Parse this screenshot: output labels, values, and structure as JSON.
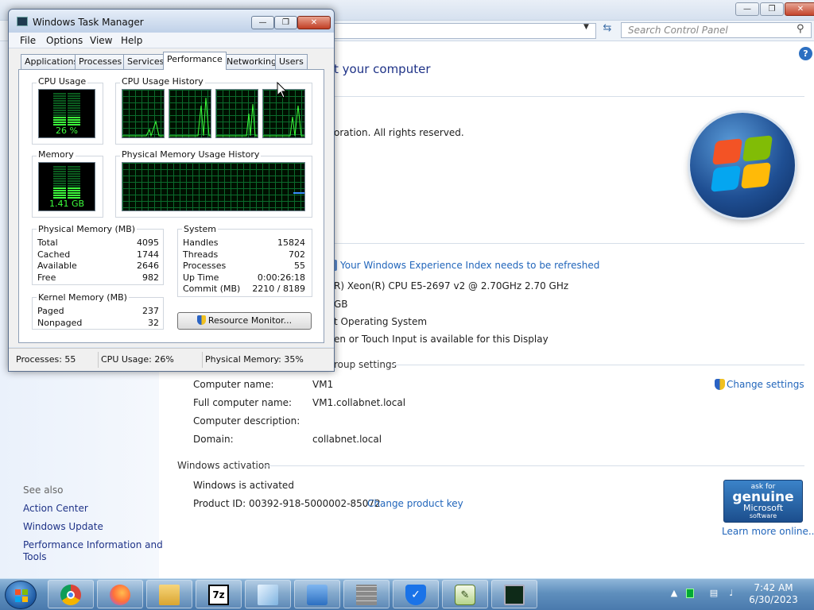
{
  "control_panel": {
    "search_placeholder": "Search Control Panel",
    "heading": "t your computer",
    "copyright": "oration.  All rights reserved.",
    "rating_link": "Your Windows Experience Index needs to be refreshed",
    "processor": "R) Xeon(R) CPU E5-2697 v2 @ 2.70GHz   2.70 GHz",
    "ram": "GB",
    "system_type": "t Operating System",
    "pen_touch": "en or Touch Input is available for this Display",
    "group_heading": "roup settings",
    "change_settings": "Change settings",
    "computer_name_label": "Computer name:",
    "computer_name": "VM1",
    "full_name_label": "Full computer name:",
    "full_name": "VM1.collabnet.local",
    "description_label": "Computer description:",
    "domain_label": "Domain:",
    "domain": "collabnet.local",
    "activation_heading": "Windows activation",
    "activated": "Windows is activated",
    "product_id": "Product ID: 00392-918-5000002-85072",
    "change_key": "Change product key",
    "learn_more": "Learn more online...",
    "genuine": {
      "line1": "ask for",
      "line2": "genuine",
      "line3": "Microsoft",
      "line4": "software"
    },
    "see_also": "See also",
    "see_also_links": [
      "Action Center",
      "Windows Update",
      "Performance Information and",
      "Tools"
    ]
  },
  "task_manager": {
    "title": "Windows Task Manager",
    "menu": [
      "File",
      "Options",
      "View",
      "Help"
    ],
    "tabs": [
      "Applications",
      "Processes",
      "Services",
      "Performance",
      "Networking",
      "Users"
    ],
    "active_tab": "Performance",
    "cpu_usage_label": "CPU Usage",
    "cpu_usage_value": "26 %",
    "cpu_history_label": "CPU Usage History",
    "memory_label": "Memory",
    "memory_value": "1.41 GB",
    "mem_history_label": "Physical Memory Usage History",
    "physical_memory": {
      "label": "Physical Memory (MB)",
      "rows": [
        {
          "name": "Total",
          "value": "4095"
        },
        {
          "name": "Cached",
          "value": "1744"
        },
        {
          "name": "Available",
          "value": "2646"
        },
        {
          "name": "Free",
          "value": "982"
        }
      ]
    },
    "kernel_memory": {
      "label": "Kernel Memory (MB)",
      "rows": [
        {
          "name": "Paged",
          "value": "237"
        },
        {
          "name": "Nonpaged",
          "value": "32"
        }
      ]
    },
    "system": {
      "label": "System",
      "rows": [
        {
          "name": "Handles",
          "value": "15824"
        },
        {
          "name": "Threads",
          "value": "702"
        },
        {
          "name": "Processes",
          "value": "55"
        },
        {
          "name": "Up Time",
          "value": "0:00:26:18"
        },
        {
          "name": "Commit (MB)",
          "value": "2210 / 8189"
        }
      ]
    },
    "resource_monitor": "Resource Monitor...",
    "status": {
      "processes": "Processes: 55",
      "cpu": "CPU Usage: 26%",
      "memory": "Physical Memory: 35%"
    },
    "cpu_fraction": 0.26,
    "memory_fraction": 0.35
  },
  "taskbar": {
    "time": "7:42 AM",
    "date": "6/30/2023",
    "apps": [
      "chrome-icon",
      "firefox-icon",
      "explorer-icon",
      "7zip-icon",
      "notepad-icon",
      "control-panel-icon",
      "firewall-icon",
      "shield-icon",
      "spreadsheet-icon",
      "task-manager-icon"
    ]
  }
}
